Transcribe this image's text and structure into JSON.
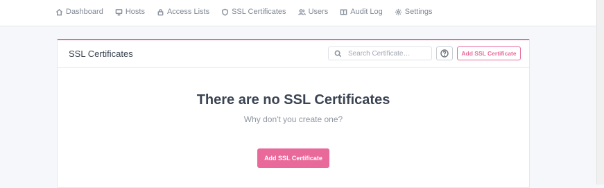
{
  "nav": {
    "items": [
      {
        "label": "Dashboard",
        "icon": "home-icon"
      },
      {
        "label": "Hosts",
        "icon": "monitor-icon"
      },
      {
        "label": "Access Lists",
        "icon": "lock-icon"
      },
      {
        "label": "SSL Certificates",
        "icon": "shield-icon"
      },
      {
        "label": "Users",
        "icon": "users-icon"
      },
      {
        "label": "Audit Log",
        "icon": "book-icon"
      },
      {
        "label": "Settings",
        "icon": "gear-icon"
      }
    ]
  },
  "card": {
    "title": "SSL Certificates",
    "search_placeholder": "Search Certificate…",
    "add_button_label": "Add SSL Certificate",
    "empty_title": "There are no SSL Certificates",
    "empty_subtitle": "Why don't you create one?",
    "empty_add_button_label": "Add SSL Certificate"
  },
  "colors": {
    "accent": "#e8699a",
    "background": "#f5f7fb"
  }
}
